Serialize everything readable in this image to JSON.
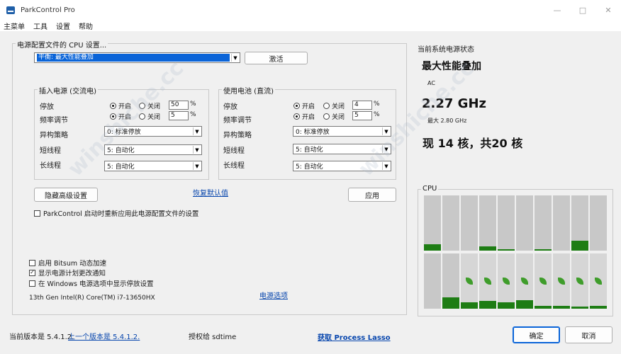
{
  "window": {
    "title": "ParkControl Pro",
    "minimize": "—",
    "maximize": "□",
    "close": "✕"
  },
  "menu": [
    "主菜单",
    "工具",
    "设置",
    "帮助"
  ],
  "config": {
    "group_title": "电源配置文件的 CPU 设置...",
    "profile_selected": "平衡: 最大性能叠加",
    "activate_label": "激活",
    "ac": {
      "title": "插入电源 (交流电)",
      "park_label": "停放",
      "park_on": "开启",
      "park_off": "关闭",
      "park_value": "50",
      "park_unit": "%",
      "freq_label": "频率调节",
      "freq_on": "开启",
      "freq_off": "关闭",
      "freq_value": "5",
      "freq_unit": "%",
      "hetero_label": "异构策略",
      "hetero_value": "0: 标准停放",
      "short_label": "短线程",
      "short_value": "5: 自动化",
      "long_label": "长线程",
      "long_value": "5: 自动化"
    },
    "dc": {
      "title": "使用电池 (直流)",
      "park_label": "停放",
      "park_on": "开启",
      "park_off": "关闭",
      "park_value": "4",
      "park_unit": "%",
      "freq_label": "频率调节",
      "freq_on": "开启",
      "freq_off": "关闭",
      "freq_value": "5",
      "freq_unit": "%",
      "hetero_label": "异构策略",
      "hetero_value": "0: 标准停放",
      "short_label": "短线程",
      "short_value": "5: 自动化",
      "long_label": "长线程",
      "long_value": "5: 自动化"
    },
    "hide_advanced_label": "隐藏高级设置",
    "restore_defaults_label": "恢复默认值",
    "apply_label": "应用",
    "reapply_label": "ParkControl 启动时重新应用此电源配置文件的设置",
    "bitsum_label": "启用 Bitsum 动态加速",
    "notify_label": "显示电源计划更改通知",
    "show_parking_label": "在 Windows 电源选项中显示停放设置",
    "cpu_name": "13th Gen Intel(R) Core(TM) i7-13650HX",
    "power_options_label": "电源选项"
  },
  "status": {
    "title": "当前系统电源状态",
    "plan": "最大性能叠加",
    "source": "AC",
    "freq": "2.27 GHz",
    "max_freq": "最大 2.80 GHz",
    "cores": "现 14 核，共20 核",
    "cpu_label": "CPU"
  },
  "cpu_cores": {
    "row1": [
      0.12,
      0,
      0,
      0.08,
      0.03,
      0,
      0.03,
      0,
      0.18,
      0
    ],
    "row2": [
      0,
      0.2,
      0.12,
      0.14,
      0.12,
      0.15,
      0.05,
      0.05,
      0.04,
      0.05
    ],
    "row2_parked": [
      false,
      false,
      true,
      true,
      true,
      true,
      true,
      true,
      true,
      true
    ]
  },
  "footer": {
    "version": "当前版本是 5.4.1.2.",
    "prev_version": "上一个版本是 5.4.1.2.",
    "licensed": "授权给 sdtime",
    "get_lasso": "获取 Process Lasso",
    "ok_label": "确定",
    "cancel_label": "取消"
  },
  "watermark": "winshiche.cc",
  "colors": {
    "accent": "#0a64d8",
    "core_active": "#1e7d14",
    "core_idle": "#c8c8c8",
    "link": "#0645ad"
  }
}
